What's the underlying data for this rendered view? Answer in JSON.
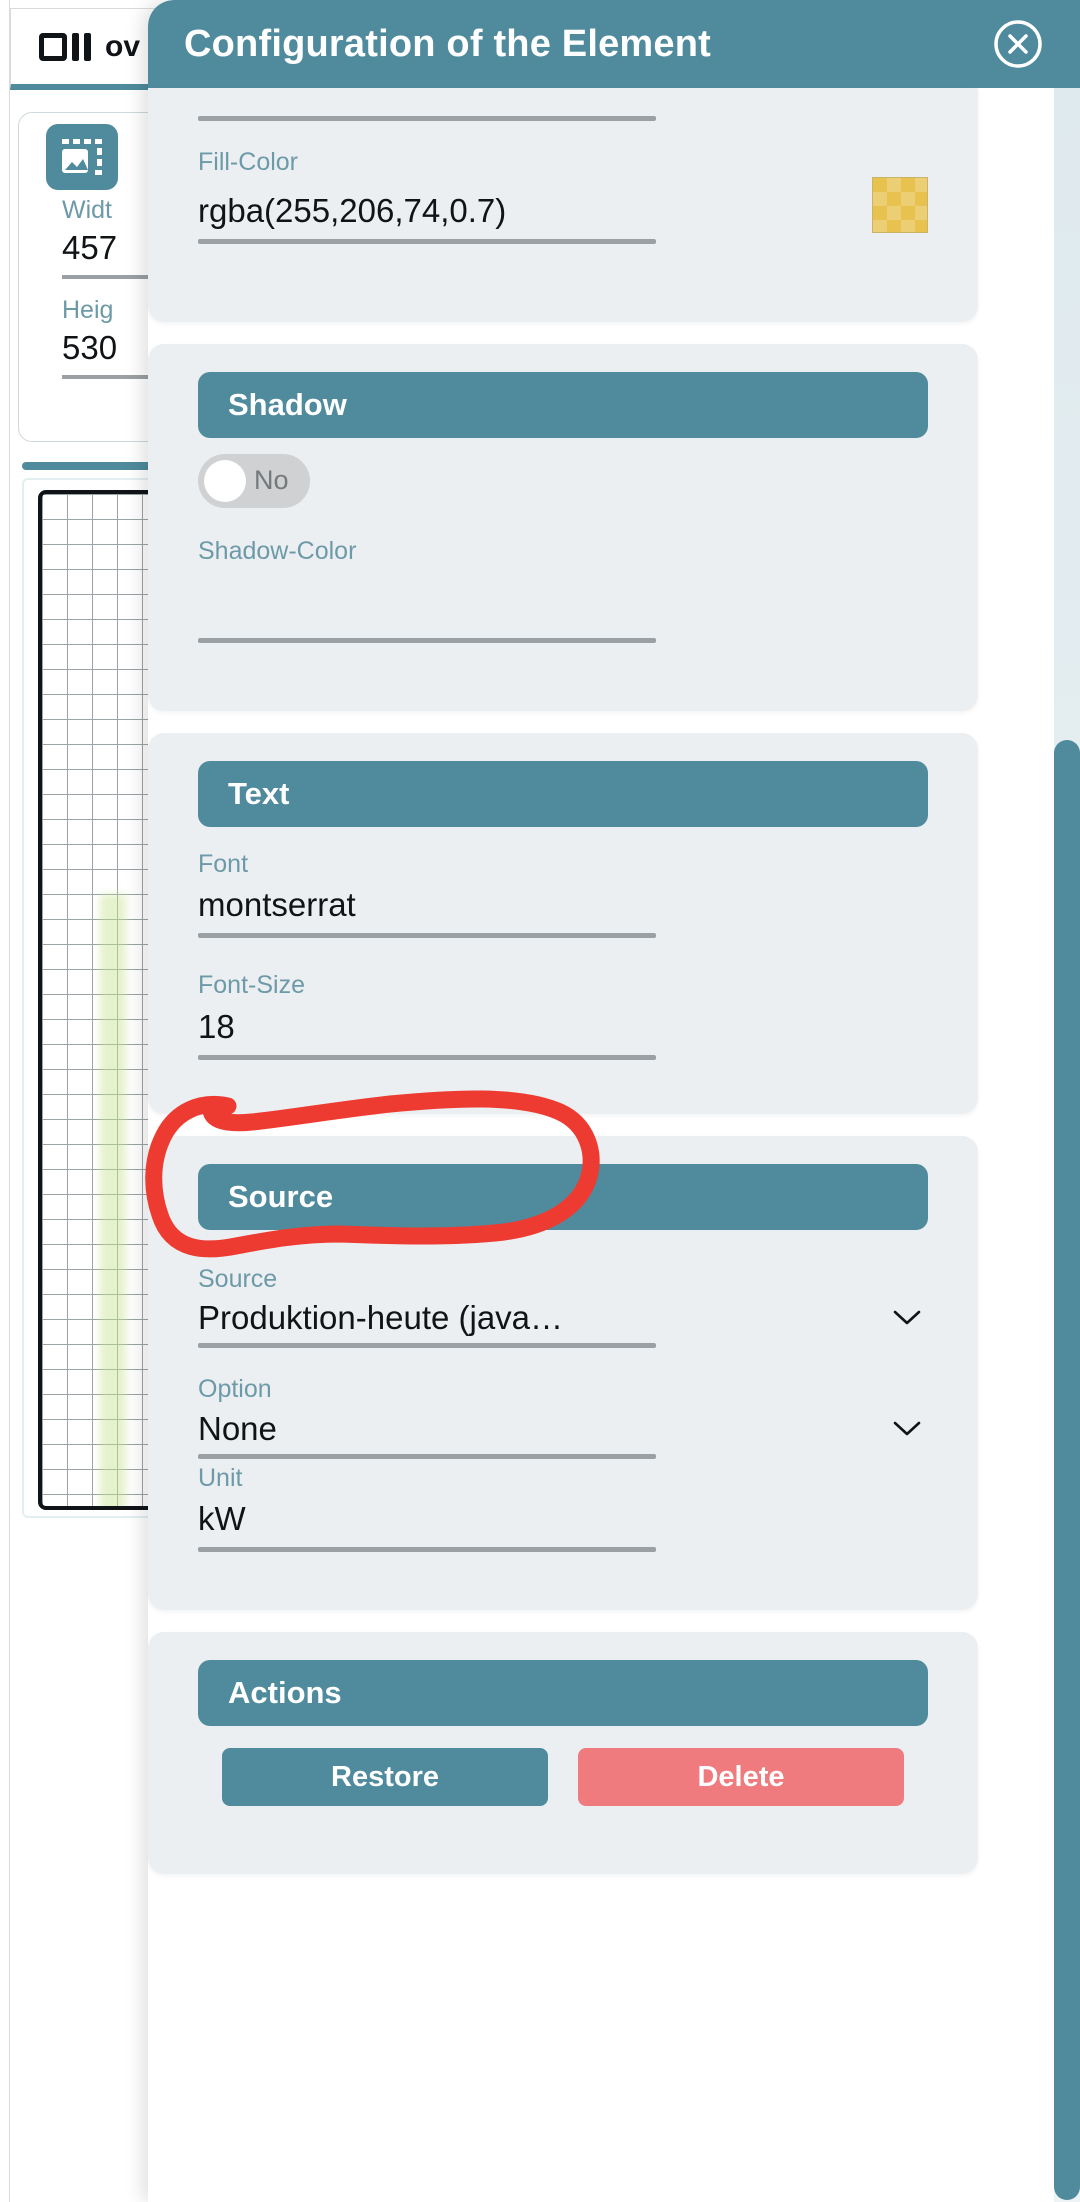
{
  "background_app": {
    "topbar": {
      "icon": "square-bars-icon",
      "title": "ov"
    },
    "properties_panel": {
      "icon": "image-frame-icon",
      "fields": [
        {
          "label": "Widt",
          "value": "457"
        },
        {
          "label": "Heig",
          "value": "530"
        }
      ]
    }
  },
  "modal": {
    "title": "Configuration of the Element",
    "close_icon": "close-circle-icon",
    "sections": [
      {
        "id": "fill",
        "header": null,
        "fields": [
          {
            "type": "text",
            "label": "Fill-Color",
            "value": "rgba(255,206,74,0.7)",
            "swatch_color": "#e7c24e"
          }
        ]
      },
      {
        "id": "shadow",
        "header": "Shadow",
        "toggle": {
          "label": "No",
          "state": "off"
        },
        "fields": [
          {
            "type": "text",
            "label": "Shadow-Color",
            "value": ""
          }
        ]
      },
      {
        "id": "text",
        "header": "Text",
        "fields": [
          {
            "type": "text",
            "label": "Font",
            "value": "montserrat"
          },
          {
            "type": "text",
            "label": "Font-Size",
            "value": "18"
          }
        ]
      },
      {
        "id": "source",
        "header": "Source",
        "fields": [
          {
            "type": "select",
            "label": "Source",
            "value": "Produktion-heute (java…"
          },
          {
            "type": "select",
            "label": "Option",
            "value": "None"
          },
          {
            "type": "text",
            "label": "Unit",
            "value": "kW"
          }
        ]
      },
      {
        "id": "actions",
        "header": "Actions",
        "buttons": [
          {
            "label": "Restore",
            "color": "#4f8b9d"
          },
          {
            "label": "Delete",
            "color": "#ef7b7e"
          }
        ]
      }
    ]
  },
  "annotation": {
    "type": "hand-drawn-ellipse",
    "color": "#ee3b32",
    "targets": "option-select-field"
  },
  "colors": {
    "accent_teal": "#4f8b9d",
    "card_bg": "#eceff1",
    "label_teal": "#6d9aa8",
    "delete_red": "#ef7b7e",
    "annotation_red": "#ee3b32"
  }
}
